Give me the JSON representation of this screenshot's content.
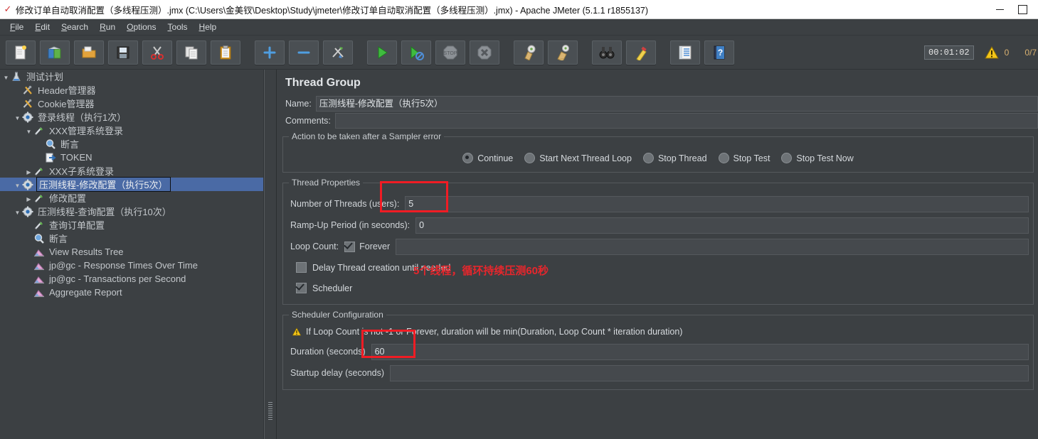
{
  "window": {
    "title": "修改订单自动取消配置（多线程压测）.jmx (C:\\Users\\金美钗\\Desktop\\Study\\jmeter\\修改订单自动取消配置（多线程压测）.jmx) - Apache JMeter (5.1.1 r1855137)",
    "app_icon": "jmeter-feather-icon",
    "minimize_label": "Minimize",
    "maximize_label": "Maximize"
  },
  "menubar": {
    "items": [
      {
        "label": "File",
        "mnemonic": "F"
      },
      {
        "label": "Edit",
        "mnemonic": "E"
      },
      {
        "label": "Search",
        "mnemonic": "S"
      },
      {
        "label": "Run",
        "mnemonic": "R"
      },
      {
        "label": "Options",
        "mnemonic": "O"
      },
      {
        "label": "Tools",
        "mnemonic": "T"
      },
      {
        "label": "Help",
        "mnemonic": "H"
      }
    ]
  },
  "toolbar": {
    "buttons": [
      {
        "name": "new-button",
        "icon": "new-document-icon"
      },
      {
        "name": "templates-button",
        "icon": "templates-icon"
      },
      {
        "name": "open-button",
        "icon": "open-folder-icon"
      },
      {
        "name": "save-button",
        "icon": "save-floppy-icon"
      },
      {
        "name": "cut-button",
        "icon": "scissors-icon"
      },
      {
        "name": "copy-button",
        "icon": "copy-pages-icon"
      },
      {
        "name": "paste-button",
        "icon": "clipboard-paste-icon"
      },
      {
        "name": "expand-all-button",
        "icon": "plus-icon"
      },
      {
        "name": "collapse-all-button",
        "icon": "minus-icon"
      },
      {
        "name": "toggle-button",
        "icon": "toggle-arrows-icon"
      },
      {
        "name": "start-button",
        "icon": "play-green-icon"
      },
      {
        "name": "start-no-pauses-button",
        "icon": "play-no-pause-icon"
      },
      {
        "name": "stop-button",
        "icon": "stop-sign-icon"
      },
      {
        "name": "shutdown-button",
        "icon": "shutdown-x-icon"
      },
      {
        "name": "clear-button",
        "icon": "clear-broom-icon"
      },
      {
        "name": "clear-all-button",
        "icon": "clear-all-broom-icon"
      },
      {
        "name": "search-button",
        "icon": "binoculars-icon"
      },
      {
        "name": "reset-search-button",
        "icon": "broom-reset-icon"
      },
      {
        "name": "function-helper-button",
        "icon": "function-helper-icon"
      },
      {
        "name": "help-button",
        "icon": "help-book-icon"
      }
    ],
    "timer": "00:01:02",
    "warning_icon": "warning-triangle-icon",
    "warning_count": "0",
    "thread_count": "0/7"
  },
  "tree": {
    "nodes": [
      {
        "label": "测试计划",
        "depth": 0,
        "toggle": "down",
        "icon": "test-plan-flask-icon",
        "selected": false
      },
      {
        "label": "Header管理器",
        "depth": 1,
        "toggle": "",
        "icon": "config-wrench-icon",
        "selected": false
      },
      {
        "label": "Cookie管理器",
        "depth": 1,
        "toggle": "",
        "icon": "config-wrench-icon",
        "selected": false
      },
      {
        "label": "登录线程（执行1次）",
        "depth": 1,
        "toggle": "down",
        "icon": "thread-group-gear-icon",
        "selected": false
      },
      {
        "label": "XXX管理系统登录",
        "depth": 2,
        "toggle": "down",
        "icon": "sampler-pipette-icon",
        "selected": false
      },
      {
        "label": "断言",
        "depth": 3,
        "toggle": "",
        "icon": "assertion-magnifier-icon",
        "selected": false
      },
      {
        "label": "TOKEN",
        "depth": 3,
        "toggle": "",
        "icon": "extractor-arrow-icon",
        "selected": false
      },
      {
        "label": "XXX子系统登录",
        "depth": 2,
        "toggle": "right",
        "icon": "sampler-pipette-icon",
        "selected": false
      },
      {
        "label": "压测线程-修改配置（执行5次）",
        "depth": 1,
        "toggle": "down",
        "icon": "thread-group-gear-icon",
        "selected": true
      },
      {
        "label": "修改配置",
        "depth": 2,
        "toggle": "right",
        "icon": "sampler-pipette-icon",
        "selected": false
      },
      {
        "label": "压测线程-查询配置（执行10次）",
        "depth": 1,
        "toggle": "down",
        "icon": "thread-group-gear-icon",
        "selected": false
      },
      {
        "label": "查询订单配置",
        "depth": 2,
        "toggle": "",
        "icon": "sampler-pipette-icon",
        "selected": false
      },
      {
        "label": "断言",
        "depth": 2,
        "toggle": "",
        "icon": "assertion-magnifier-icon",
        "selected": false
      },
      {
        "label": "View Results Tree",
        "depth": 2,
        "toggle": "",
        "icon": "listener-chart-icon",
        "selected": false
      },
      {
        "label": "jp@gc - Response Times Over Time",
        "depth": 2,
        "toggle": "",
        "icon": "listener-chart-icon",
        "selected": false
      },
      {
        "label": "jp@gc - Transactions per Second",
        "depth": 2,
        "toggle": "",
        "icon": "listener-chart-icon",
        "selected": false
      },
      {
        "label": "Aggregate Report",
        "depth": 2,
        "toggle": "",
        "icon": "listener-chart-icon",
        "selected": false
      }
    ]
  },
  "main": {
    "title": "Thread Group",
    "name_label": "Name:",
    "name_value": "压测线程-修改配置（执行5次）",
    "comments_label": "Comments:",
    "comments_value": "",
    "sampler_error": {
      "group_title": "Action to be taken after a Sampler error",
      "options": [
        {
          "label": "Continue",
          "selected": true
        },
        {
          "label": "Start Next Thread Loop",
          "selected": false
        },
        {
          "label": "Stop Thread",
          "selected": false
        },
        {
          "label": "Stop Test",
          "selected": false
        },
        {
          "label": "Stop Test Now",
          "selected": false
        }
      ]
    },
    "thread_properties": {
      "group_title": "Thread Properties",
      "num_threads_label": "Number of Threads (users):",
      "num_threads_value": "5",
      "rampup_label": "Ramp-Up Period (in seconds):",
      "rampup_value": "0",
      "loop_count_label": "Loop Count:",
      "forever_label": "Forever",
      "forever_checked": true,
      "loop_count_value": "",
      "delay_thread_label": "Delay Thread creation until needed",
      "delay_thread_checked": false,
      "scheduler_label": "Scheduler",
      "scheduler_checked": true
    },
    "scheduler": {
      "group_title": "Scheduler Configuration",
      "warning_icon": "warning-triangle-icon",
      "warning_text": "If Loop Count is not -1 or Forever, duration will be min(Duration, Loop Count * iteration duration)",
      "duration_label": "Duration (seconds)",
      "duration_value": "60",
      "startup_delay_label": "Startup delay (seconds)",
      "startup_delay_value": ""
    },
    "annotation": {
      "text": "5个线程，循环持续压测60秒",
      "color": "#e8262c"
    }
  },
  "colors": {
    "background": "#3c4043",
    "field": "#45494d",
    "selection": "#4a6aa5",
    "annotation_red": "#f01c24",
    "text": "#c8ccd0"
  }
}
